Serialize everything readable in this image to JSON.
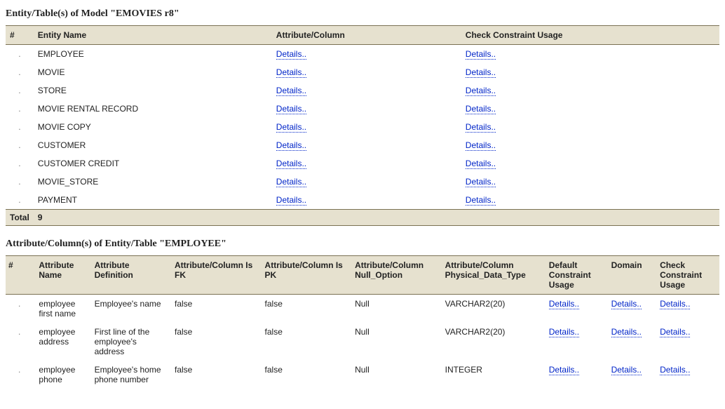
{
  "section1": {
    "title": "Entity/Table(s) of Model \"EMOVIES r8\"",
    "columns": {
      "num": "#",
      "entity_name": "Entity Name",
      "attribute_column": "Attribute/Column",
      "check_constraint": "Check Constraint Usage"
    },
    "rows": [
      {
        "bullet": ".",
        "name": "EMPLOYEE",
        "attr": "Details..",
        "check": "Details.."
      },
      {
        "bullet": ".",
        "name": "MOVIE",
        "attr": "Details..",
        "check": "Details.."
      },
      {
        "bullet": ".",
        "name": "STORE",
        "attr": "Details..",
        "check": "Details.."
      },
      {
        "bullet": ".",
        "name": "MOVIE RENTAL RECORD",
        "attr": "Details..",
        "check": "Details.."
      },
      {
        "bullet": ".",
        "name": "MOVIE COPY",
        "attr": "Details..",
        "check": "Details.."
      },
      {
        "bullet": ".",
        "name": "CUSTOMER",
        "attr": "Details..",
        "check": "Details.."
      },
      {
        "bullet": ".",
        "name": "CUSTOMER CREDIT",
        "attr": "Details..",
        "check": "Details.."
      },
      {
        "bullet": ".",
        "name": "MOVIE_STORE",
        "attr": "Details..",
        "check": "Details.."
      },
      {
        "bullet": ".",
        "name": "PAYMENT",
        "attr": "Details..",
        "check": "Details.."
      }
    ],
    "total_label": "Total",
    "total_value": "9"
  },
  "section2": {
    "title": "Attribute/Column(s) of Entity/Table \"EMPLOYEE\"",
    "columns": {
      "num": "#",
      "attr_name": "Attribute Name",
      "attr_def": "Attribute Definition",
      "is_fk": "Attribute/Column Is FK",
      "is_pk": "Attribute/Column Is PK",
      "null_option": "Attribute/Column Null_Option",
      "data_type": "Attribute/Column Physical_Data_Type",
      "default_constraint": "Default Constraint Usage",
      "domain": "Domain",
      "check_constraint": "Check Constraint Usage"
    },
    "rows": [
      {
        "bullet": ".",
        "name": "employee first name",
        "def": "Employee's name",
        "fk": "false",
        "pk": "false",
        "null": "Null",
        "type": "VARCHAR2(20)",
        "default": "Details..",
        "domain": "Details..",
        "check": "Details.."
      },
      {
        "bullet": ".",
        "name": "employee address",
        "def": "First line of the employee's address",
        "fk": "false",
        "pk": "false",
        "null": "Null",
        "type": "VARCHAR2(20)",
        "default": "Details..",
        "domain": "Details..",
        "check": "Details.."
      },
      {
        "bullet": ".",
        "name": "employee phone",
        "def": "Employee's home phone number",
        "fk": "false",
        "pk": "false",
        "null": "Null",
        "type": "INTEGER",
        "default": "Details..",
        "domain": "Details..",
        "check": "Details.."
      }
    ]
  }
}
